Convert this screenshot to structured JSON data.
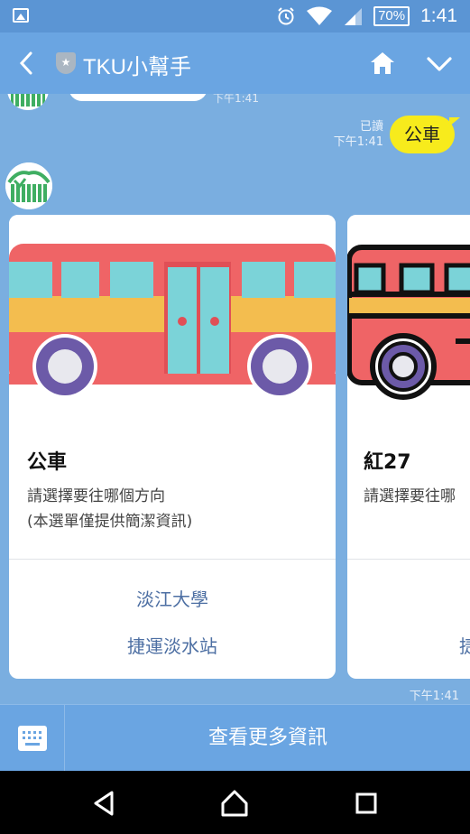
{
  "status_bar": {
    "battery": "70%",
    "time": "1:41",
    "icons": [
      "image-icon",
      "alarm-icon",
      "wifi-icon",
      "signal-icon",
      "battery-icon"
    ]
  },
  "header": {
    "title": "TKU小幫手",
    "icons": [
      "back-arrow-icon",
      "shield-star-icon",
      "home-icon",
      "chevron-down-icon"
    ]
  },
  "chat": {
    "top_timestamp": "下午1:41",
    "user_message": {
      "read_label": "已讀",
      "time": "下午1:41",
      "text": "公車"
    },
    "cards": [
      {
        "title": "公車",
        "description_line1": "請選擇要往哪個方向",
        "description_line2": "(本選單僅提供簡潔資訊)",
        "actions": [
          "淡江大學",
          "捷運淡水站"
        ]
      },
      {
        "title": "紅27",
        "description_line1": "請選擇要往哪",
        "actions": [
          "",
          "捷"
        ]
      }
    ],
    "carousel_time": "下午1:41"
  },
  "bottom_bar": {
    "more_info_label": "查看更多資訊",
    "keyboard_icon": "keyboard-icon"
  },
  "nav_bar": {
    "icons": [
      "back-triangle-icon",
      "home-circle-icon",
      "recents-square-icon"
    ]
  },
  "colors": {
    "header_blue": "#6aa5e2",
    "chat_bg": "#7aaee0",
    "user_bubble": "#f7eb1c",
    "bus_red": "#ef6466",
    "bus_yellow": "#f3bd4f",
    "bus_window": "#7bd3d8",
    "link_blue": "#4d6fa3"
  }
}
